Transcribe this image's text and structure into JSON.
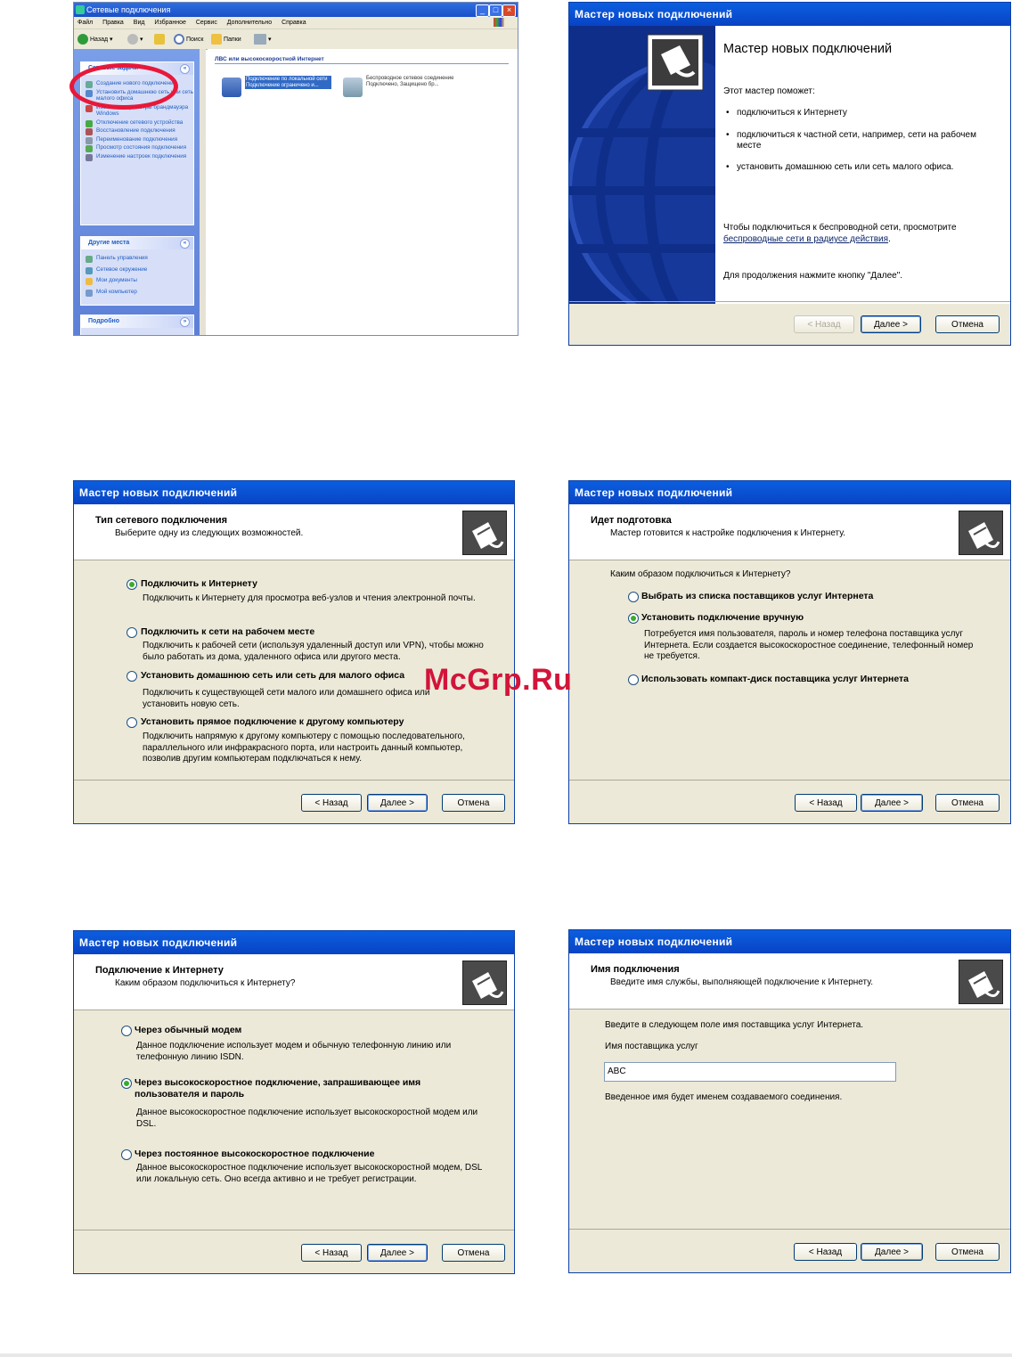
{
  "explorer": {
    "title": "Сетевые подключения",
    "menu": [
      "Файл",
      "Правка",
      "Вид",
      "Избранное",
      "Сервис",
      "Дополнительно",
      "Справка"
    ],
    "toolbar": {
      "back": "Назад",
      "search": "Поиск",
      "folders": "Папки"
    },
    "tasks_panel_title": "Сетевые задачи",
    "tasks": [
      "Создание нового подключения",
      "Установить домашнюю сеть или сеть малого офиса",
      "Изменить параметры брандмауэра Windows",
      "Отключение сетевого устройства",
      "Восстановление подключения",
      "Переименование подключения",
      "Просмотр состояния подключения",
      "Изменение настроек подключения"
    ],
    "places_panel_title": "Другие места",
    "places": [
      "Панель управления",
      "Сетевое окружение",
      "Мои документы",
      "Мой компьютер"
    ],
    "details_panel_title": "Подробно",
    "group_header": "ЛВС или высокоскоростной Интернет",
    "connections": [
      {
        "name": "Подключение по локальной сети",
        "status": "Подключение ограничено и..."
      },
      {
        "name": "Беспроводное сетевое соединение",
        "status": "Подключено, Защищено бр..."
      }
    ]
  },
  "wizard_title": "Мастер новых подключений",
  "buttons": {
    "back": "< Назад",
    "next": "Далее >",
    "cancel": "Отмена"
  },
  "wiz1": {
    "heading": "Мастер новых подключений",
    "intro": "Этот мастер поможет:",
    "bullets": [
      "подключиться к Интернету",
      "подключиться к частной сети, например, сети на рабочем месте",
      "установить домашнюю сеть или сеть малого офиса."
    ],
    "wireless_pre": "Чтобы подключиться к беспроводной сети, просмотрите",
    "wireless_link": "беспроводные сети в радиусе действия",
    "wireless_post": ".",
    "continue": "Для продолжения нажмите кнопку \"Далее\"."
  },
  "wiz2": {
    "h1": "Тип сетевого подключения",
    "h2": "Выберите одну из следующих возможностей.",
    "options": [
      {
        "label": "Подключить к Интернету",
        "desc": "Подключить к Интернету для просмотра веб-узлов и чтения электронной почты.",
        "selected": true
      },
      {
        "label": "Подключить к сети на рабочем месте",
        "desc": "Подключить к рабочей сети (используя удаленный доступ или VPN), чтобы можно было работать из дома, удаленного офиса или другого места.",
        "selected": false
      },
      {
        "label": "Установить домашнюю сеть или сеть для малого офиса",
        "desc": "Подключить к существующей сети малого или домашнего офиса или установить новую сеть.",
        "selected": false
      },
      {
        "label": "Установить прямое подключение к другому компьютеру",
        "desc": "Подключить напрямую к другому компьютеру с помощью последовательного, параллельного или инфракрасного порта, или настроить данный компьютер, позволив другим компьютерам подключаться к нему.",
        "selected": false
      }
    ]
  },
  "wiz3": {
    "h1": "Идет подготовка",
    "h2": "Мастер готовится к настройке подключения к Интернету.",
    "question": "Каким образом подключиться к Интернету?",
    "options": [
      {
        "label": "Выбрать из списка поставщиков услуг Интернета",
        "desc": "",
        "selected": false
      },
      {
        "label": "Установить подключение вручную",
        "desc": "Потребуется имя пользователя, пароль и номер телефона поставщика услуг Интернета. Если создается высокоскоростное соединение, телефонный номер не требуется.",
        "selected": true
      },
      {
        "label": "Использовать компакт-диск поставщика услуг Интернета",
        "desc": "",
        "selected": false
      }
    ]
  },
  "wiz4": {
    "h1": "Подключение к Интернету",
    "h2": "Каким образом подключиться к Интернету?",
    "options": [
      {
        "label": "Через обычный модем",
        "desc": "Данное подключение использует модем и обычную телефонную линию или телефонную линию ISDN.",
        "selected": false
      },
      {
        "label": "Через высокоскоростное подключение, запрашивающее имя пользователя и пароль",
        "desc": "Данное высокоскоростное подключение использует высокоскоростной модем или DSL.",
        "selected": true
      },
      {
        "label": "Через постоянное высокоскоростное подключение",
        "desc": "Данное высокоскоростное подключение использует высокоскоростной модем, DSL или локальную сеть. Оно всегда активно и не требует регистрации.",
        "selected": false
      }
    ]
  },
  "wiz5": {
    "h1": "Имя подключения",
    "h2": "Введите имя службы, выполняющей подключение к Интернету.",
    "instruction": "Введите в следующем поле имя поставщика услуг Интернета.",
    "field_label": "Имя поставщика услуг",
    "field_value": "ABC",
    "note": "Введенное имя будет именем создаваемого соединения."
  },
  "watermark": "McGrp.Ru",
  "colors": {
    "title_blue": "#0843c4",
    "panel_bg": "#ece9d8",
    "radio_green": "#3aab2a",
    "highlight_red": "#e8183a"
  }
}
